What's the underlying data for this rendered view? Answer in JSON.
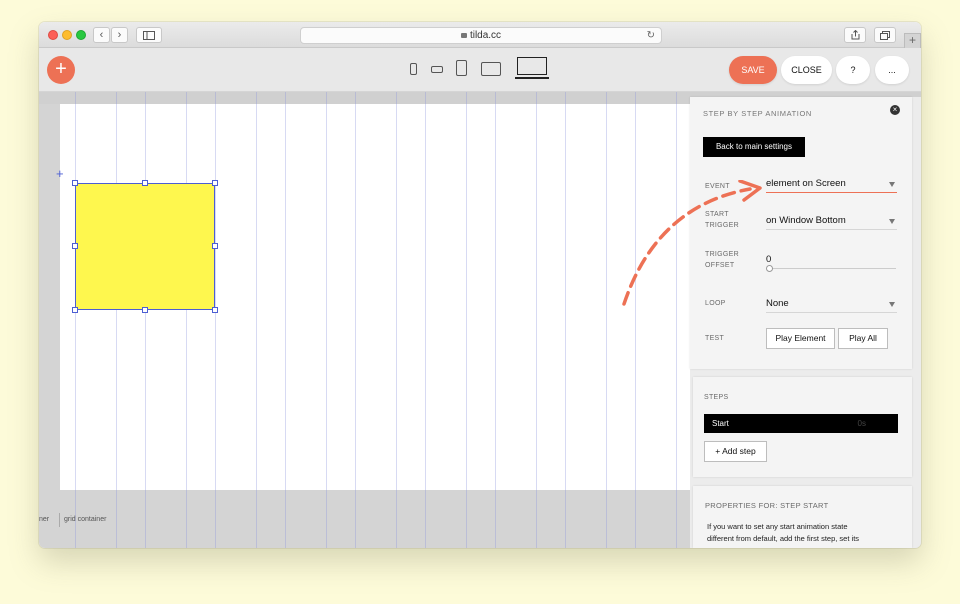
{
  "browser": {
    "url": "tilda.cc"
  },
  "toolbar": {
    "add_label": "+",
    "save_label": "SAVE",
    "close_label": "CLOSE",
    "help_label": "?",
    "more_label": "..."
  },
  "canvas": {
    "bottom_left_label": "ner",
    "bottom_label": "grid container"
  },
  "panel": {
    "title": "STEP BY STEP ANIMATION",
    "close_icon": "×",
    "back_button": "Back to main settings",
    "event_label": "EVENT",
    "event_value": "element on Screen",
    "start_trigger_label_1": "START",
    "start_trigger_label_2": "TRIGGER",
    "start_trigger_value": "on Window Bottom",
    "trigger_offset_label_1": "TRIGGER",
    "trigger_offset_label_2": "OFFSET",
    "trigger_offset_value": "0",
    "loop_label": "LOOP",
    "loop_value": "None",
    "test_label": "TEST",
    "play_element": "Play Element",
    "play_all": "Play All",
    "steps_title": "STEPS",
    "step_start_label": "Start",
    "step_start_time": "0s",
    "add_step": "+ Add step",
    "props_title": "PROPERTIES FOR: STEP START",
    "props_line_1": "If you want to set any start animation state",
    "props_line_2": "different from default, add the first step, set its"
  },
  "colors": {
    "accent": "#ed7155",
    "element_fill": "#fef74e",
    "selection": "#4c5ed3"
  }
}
